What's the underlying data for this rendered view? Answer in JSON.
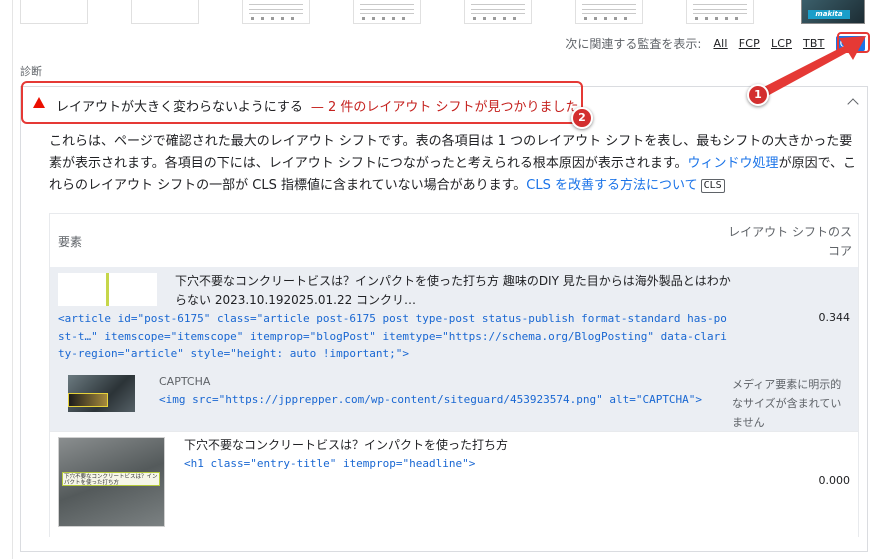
{
  "colors": {
    "fail": "#eb0f00",
    "link": "#1a73e8",
    "code": "#1967d2",
    "annotation": "#e53935",
    "row_highlight": "#ebeef3"
  },
  "filmstrip": {
    "frame_count": 8,
    "last_frame_brand": "makita"
  },
  "relevant_audits": {
    "label": "次に関連する監査を表示:",
    "chips": [
      "All",
      "FCP",
      "LCP",
      "TBT",
      "CLS"
    ],
    "active": "CLS"
  },
  "group_title": "診断",
  "audit": {
    "icon": "fail-triangle-icon",
    "title": "レイアウトが大きく変わらないようにする",
    "display_value": "— 2 件のレイアウト シフトが見つかりました",
    "description": {
      "text1": "これらは、ページで確認された最大のレイアウト シフトです。表の各項目は 1 つのレイアウト シフトを表し、最もシフトの大きかった要素が表示されます。各項目の下には、レイアウト シフトにつながったと考えられる根本原因が表示されます。",
      "link1": "ウィンドウ処理",
      "text2": "が原因で、これらのレイアウト シフトの一部が CLS 指標値に含まれていない場合があります。",
      "link2": "CLS を改善する方法について",
      "tag": "CLS"
    },
    "table": {
      "headers": {
        "element": "要素",
        "score": "レイアウト シフトのスコア"
      },
      "rows": [
        {
          "snippet": "下穴不要なコンクリートビスは？インパクトを使った打ち方 趣味のDIY 見た目からは海外製品とはわからない 2023.10.192025.01.22 コンクリ…",
          "code": "<article id=\"post-6175\" class=\"article post-6175 post type-post status-publish format-standard has-post-t…\" itemscope=\"itemscope\" itemprop=\"blogPost\" itemtype=\"https://schema.org/BlogPosting\" data-clarity-region=\"article\" style=\"height: auto !important;\">",
          "score": "0.344",
          "sub": {
            "label": "CAPTCHA",
            "code": "<img src=\"https://jpprepper.com/wp-content/siteguard/453923574.png\" alt=\"CAPTCHA\">",
            "reason": "メディア要素に明示的なサイズが含まれていません"
          }
        },
        {
          "snippet": "下穴不要なコンクリートビスは？インパクトを使った打ち方",
          "code": "<h1 class=\"entry-title\" itemprop=\"headline\">",
          "score": "0.000",
          "thumb_caption": "下穴不要なコンクリートビスは？インパクトを使った打ち方"
        }
      ]
    }
  },
  "annotations": {
    "badge1": "1",
    "badge2": "2"
  }
}
